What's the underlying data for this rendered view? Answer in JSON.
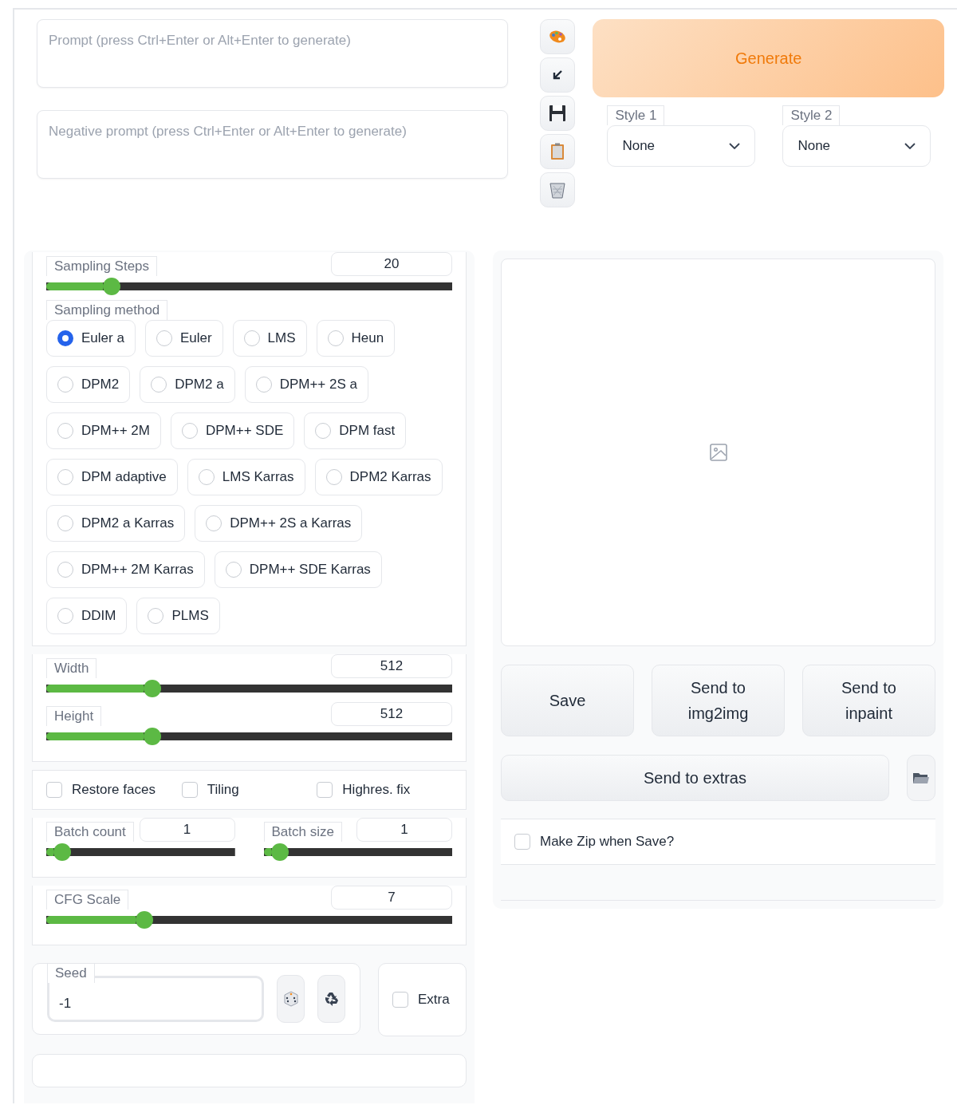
{
  "prompt": {
    "placeholder": "Prompt (press Ctrl+Enter or Alt+Enter to generate)"
  },
  "negative_prompt": {
    "placeholder": "Negative prompt (press Ctrl+Enter or Alt+Enter to generate)"
  },
  "generate_button": "Generate",
  "styles": [
    {
      "label": "Style 1",
      "value": "None"
    },
    {
      "label": "Style 2",
      "value": "None"
    }
  ],
  "sampling_steps": {
    "label": "Sampling Steps",
    "value": "20",
    "level": 0.14
  },
  "sampling_method": {
    "label": "Sampling method",
    "options": [
      {
        "label": "Euler a",
        "selected": true
      },
      {
        "label": "Euler",
        "selected": false
      },
      {
        "label": "LMS",
        "selected": false
      },
      {
        "label": "Heun",
        "selected": false
      },
      {
        "label": "DPM2",
        "selected": false
      },
      {
        "label": "DPM2 a",
        "selected": false
      },
      {
        "label": "DPM++ 2S a",
        "selected": false
      },
      {
        "label": "DPM++ 2M",
        "selected": false
      },
      {
        "label": "DPM++ SDE",
        "selected": false
      },
      {
        "label": "DPM fast",
        "selected": false
      },
      {
        "label": "DPM adaptive",
        "selected": false
      },
      {
        "label": "LMS Karras",
        "selected": false
      },
      {
        "label": "DPM2 Karras",
        "selected": false
      },
      {
        "label": "DPM2 a Karras",
        "selected": false
      },
      {
        "label": "DPM++ 2S a Karras",
        "selected": false
      },
      {
        "label": "DPM++ 2M Karras",
        "selected": false
      },
      {
        "label": "DPM++ SDE Karras",
        "selected": false
      },
      {
        "label": "DDIM",
        "selected": false
      },
      {
        "label": "PLMS",
        "selected": false
      }
    ]
  },
  "size_sliders": [
    {
      "label": "Width",
      "value": "512",
      "level": 0.24
    },
    {
      "label": "Height",
      "value": "512",
      "level": 0.24
    }
  ],
  "options": [
    {
      "label": "Restore faces",
      "checked": false
    },
    {
      "label": "Tiling",
      "checked": false
    },
    {
      "label": "Highres. fix",
      "checked": false
    }
  ],
  "batch_sliders": [
    {
      "label": "Batch count",
      "value": "1",
      "level": 0.04
    },
    {
      "label": "Batch size",
      "value": "1",
      "level": 0.04
    }
  ],
  "cfg_scale": {
    "label": "CFG Scale",
    "value": "7",
    "level": 0.22
  },
  "seed": {
    "label": "Seed",
    "value": "-1"
  },
  "extra": {
    "label": "Extra",
    "checked": false
  },
  "output_buttons": [
    "Save",
    "Send to img2img",
    "Send to inpaint"
  ],
  "send_to_extras": "Send to extras",
  "make_zip": {
    "label": "Make Zip when Save?",
    "checked": false
  }
}
